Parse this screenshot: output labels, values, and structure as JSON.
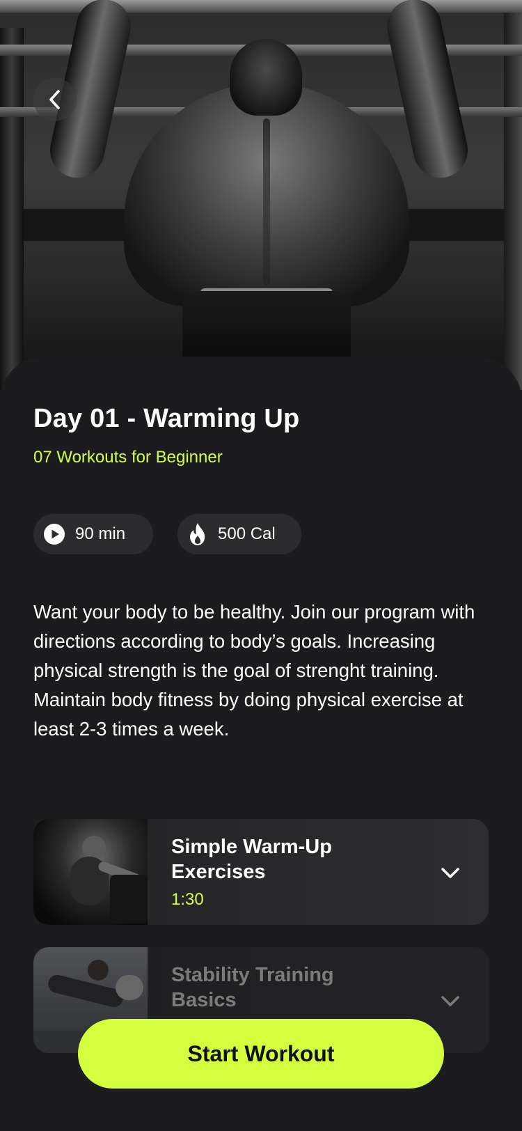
{
  "header": {
    "back_icon": "chevron-left-icon"
  },
  "workout": {
    "title": "Day 01 - Warming Up",
    "subtitle": "07 Workouts for Beginner",
    "stats": {
      "duration": {
        "icon": "play-circle-icon",
        "label": "90 min"
      },
      "calories": {
        "icon": "flame-icon",
        "label": "500 Cal"
      }
    },
    "description": "Want your body to be healthy. Join our program with directions according to body’s goals. Increasing physical strength is the goal of strenght training. Maintain body fitness by doing physical exercise at least 2-3 times a week."
  },
  "exercises": [
    {
      "title": "Simple Warm-Up Exercises",
      "time": "1:30",
      "icon": "chevron-down-icon"
    },
    {
      "title": "Stability Training Basics",
      "time": "",
      "icon": "chevron-down-icon"
    }
  ],
  "actions": {
    "start_label": "Start Workout"
  },
  "colors": {
    "accent": "#d4ff3f",
    "background": "#1c1c1e",
    "chip": "#2c2c2e"
  }
}
